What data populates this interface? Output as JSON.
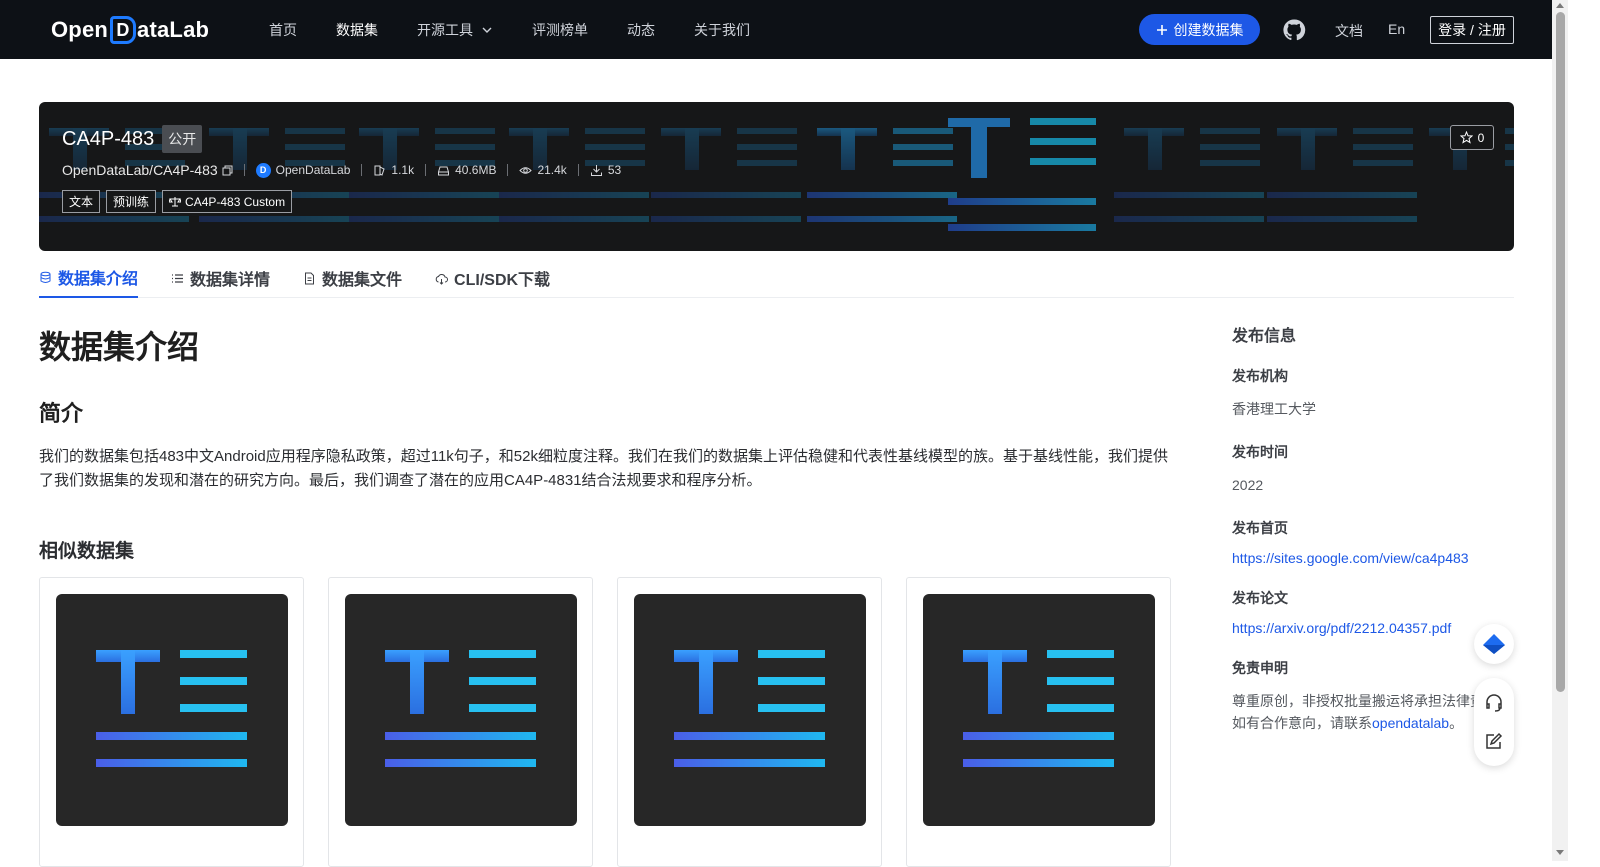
{
  "nav": {
    "logo_left": "Open",
    "logo_d": "D",
    "logo_right": "ataLab",
    "items": [
      {
        "label": "首页"
      },
      {
        "label": "数据集"
      },
      {
        "label": "开源工具"
      },
      {
        "label": "评测榜单"
      },
      {
        "label": "动态"
      },
      {
        "label": "关于我们"
      }
    ],
    "create_label": "创建数据集",
    "docs_label": "文档",
    "lang_label": "En",
    "login_label": "登录 / 注册"
  },
  "dataset": {
    "title": "CA4P-483",
    "visibility": "公开",
    "path": "OpenDataLab/CA4P-483",
    "org": "OpenDataLab",
    "files": "1.1k",
    "size": "40.6MB",
    "views": "21.4k",
    "downloads": "53",
    "tags": [
      "文本",
      "预训练"
    ],
    "license": "CA4P-483 Custom",
    "stars": "0"
  },
  "tabs": [
    {
      "label": "数据集介绍"
    },
    {
      "label": "数据集详情"
    },
    {
      "label": "数据集文件"
    },
    {
      "label": "CLI/SDK下载"
    }
  ],
  "main": {
    "heading": "数据集介绍",
    "intro_heading": "简介",
    "intro_text": "我们的数据集包括483中文Android应用程序隐私政策，超过11k句子，和52k细粒度注释。我们在我们的数据集上评估稳健和代表性基线模型的族。基于基线性能，我们提供了我们数据集的发现和潜在的研究方向。最后，我们调查了潜在的应用CA4P-4831结合法规要求和程序分析。",
    "similar_heading": "相似数据集"
  },
  "sidebar": {
    "title": "发布信息",
    "org_label": "发布机构",
    "org_value": "香港理工大学",
    "time_label": "发布时间",
    "time_value": "2022",
    "home_label": "发布首页",
    "home_value": "https://sites.google.com/view/ca4p483",
    "paper_label": "发布论文",
    "paper_value": "https://arxiv.org/pdf/2212.04357.pdf",
    "disclaimer_label": "免责申明",
    "disclaimer_line1": "尊重原创，非授权批量搬运将承担法律责",
    "disclaimer_line2_prefix": "如有合作意向，请联系",
    "disclaimer_contact": "opendatalab",
    "disclaimer_line2_suffix": "。"
  },
  "colors": {
    "brand": "#1d58e6",
    "nav_bg": "#0d1116",
    "banner_bg": "#161718"
  },
  "icons": [
    "github-icon",
    "plus-icon",
    "chevron-down-icon",
    "copy-icon",
    "files-icon",
    "disk-icon",
    "eye-icon",
    "download-icon",
    "scale-icon",
    "star-icon",
    "database-icon",
    "list-icon",
    "file-icon",
    "cloud-icon",
    "headset-icon",
    "edit-icon",
    "paper-plane-icon",
    "text-dataset-icon"
  ]
}
